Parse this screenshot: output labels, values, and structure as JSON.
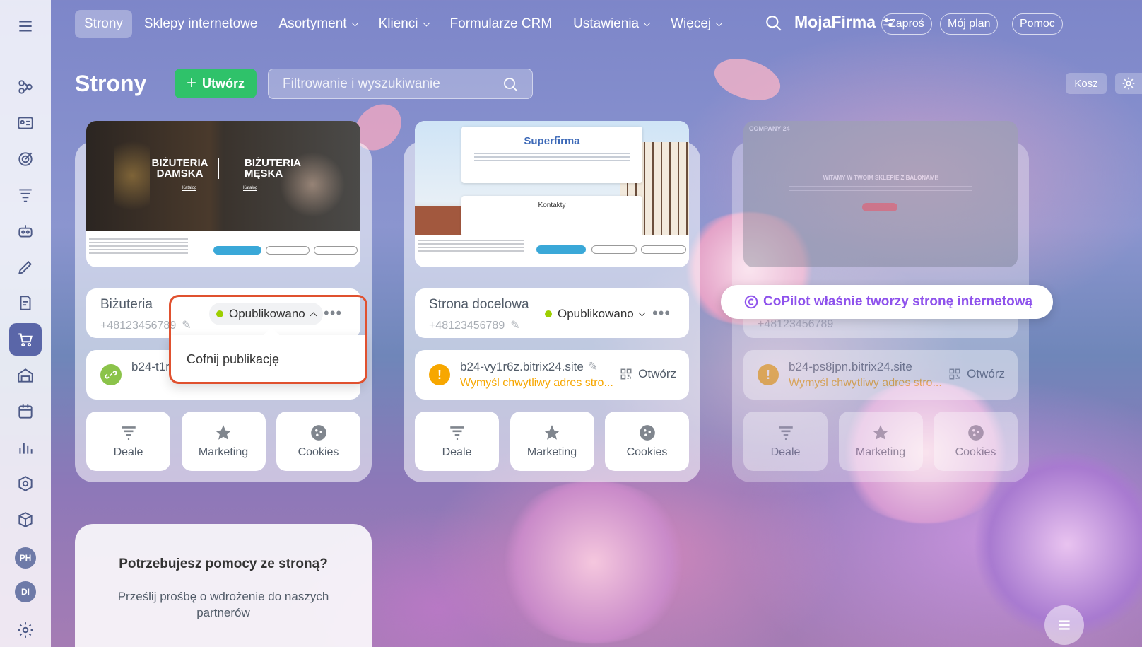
{
  "nav": {
    "items": [
      {
        "label": "Strony",
        "active": true,
        "dropdown": false
      },
      {
        "label": "Sklepy internetowe",
        "active": false,
        "dropdown": false
      },
      {
        "label": "Asortyment",
        "active": false,
        "dropdown": true
      },
      {
        "label": "Klienci",
        "active": false,
        "dropdown": true
      },
      {
        "label": "Formularze CRM",
        "active": false,
        "dropdown": false
      },
      {
        "label": "Ustawienia",
        "active": false,
        "dropdown": true
      },
      {
        "label": "Więcej",
        "active": false,
        "dropdown": true
      }
    ],
    "brand": "MojaFirma",
    "invite": "Zaproś",
    "plan": "Mój plan",
    "help": "Pomoc"
  },
  "sidebar": {
    "icons": [
      "menu-icon",
      "flow-icon",
      "contact-card-icon",
      "target-icon",
      "funnel-icon",
      "robot-icon",
      "pen-icon",
      "document-edit-icon",
      "cart-icon",
      "warehouse-icon",
      "calendar-icon",
      "chart-icon",
      "hexagon-icon",
      "box-icon"
    ],
    "avatars": [
      "PH",
      "DI"
    ]
  },
  "header": {
    "title": "Strony",
    "create": "Utwórz",
    "search_placeholder": "Filtrowanie i wyszukiwanie",
    "trash": "Kosz"
  },
  "cards": [
    {
      "name": "Biżuteria",
      "phone": "+48123456789",
      "status": "Opublikowano",
      "url": "b24-t1r",
      "warning": "",
      "open": "",
      "thumb": {
        "left_title": "BIŻUTERIA DAMSKA",
        "right_title": "BIŻUTERIA MĘSKA",
        "button": "Katalog"
      }
    },
    {
      "name": "Strona docelowa",
      "phone": "+48123456789",
      "status": "Opublikowano",
      "url": "b24-vy1r6z.bitrix24.site",
      "warning": "Wymyśl chwytliwy adres stro...",
      "open": "Otwórz",
      "thumb": {
        "title": "Superfirma",
        "contacts": "Kontakty"
      }
    },
    {
      "name": "",
      "phone": "+48123456789",
      "status": "",
      "url": "b24-ps8jpn.bitrix24.site",
      "warning": "Wymyśl chwytliwy adres stro...",
      "open": "Otwórz",
      "thumb": {
        "company": "COMPANY 24",
        "headline": "WITAMY W TWOIM SKLEPIE Z BALONAMI!"
      }
    }
  ],
  "actions": {
    "deals": "Deale",
    "marketing": "Marketing",
    "cookies": "Cookies"
  },
  "popup": {
    "unpublish": "Cofnij publikację"
  },
  "copilot": "CoPilot właśnie tworzy stronę internetową",
  "help_card": {
    "title": "Potrzebujesz pomocy ze stroną?",
    "subtitle": "Prześlij prośbę o wdrożenie do naszych partnerów"
  },
  "colors": {
    "accent_green": "#2fc26a",
    "warning": "#f7a700",
    "highlight": "#e0512f",
    "copilot": "#8e52ec"
  }
}
